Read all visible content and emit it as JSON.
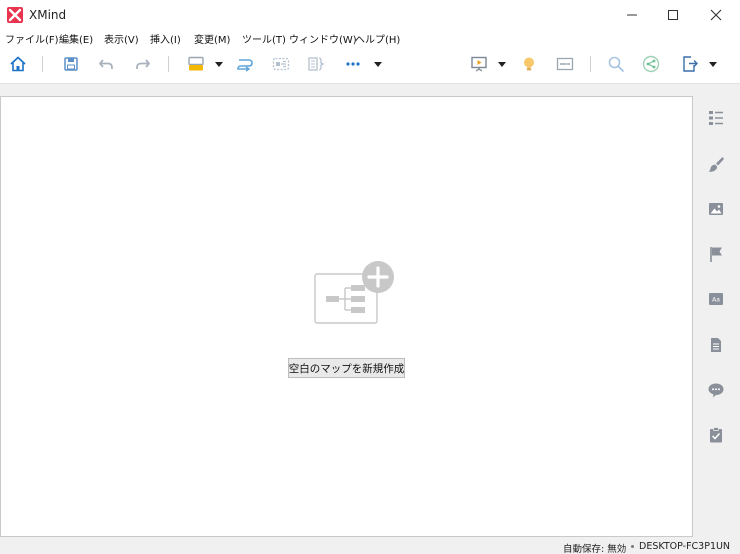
{
  "window": {
    "title": "XMind",
    "controls": [
      "minimize",
      "maximize",
      "close"
    ]
  },
  "menu": {
    "items": [
      "ファイル(F)",
      "編集(E)",
      "表示(V)",
      "挿入(I)",
      "変更(M)",
      "ツール(T)",
      "ウィンドウ(W)",
      "ヘルプ(H)"
    ]
  },
  "toolbar": {
    "icons": [
      "home-icon",
      "save-icon",
      "undo-icon",
      "redo-icon",
      "topic-style-icon",
      "relationship-icon",
      "boundary-icon",
      "summary-icon",
      "more-icon",
      "presentation-icon",
      "brainstorm-icon",
      "outline-mode-icon",
      "search-icon",
      "share-icon",
      "export-icon"
    ]
  },
  "canvas": {
    "new_map_button": "空白のマップを新規作成"
  },
  "sidebar": {
    "icons": [
      "outliner-icon",
      "format-icon",
      "image-icon",
      "marker-icon",
      "clipart-icon",
      "notes-icon",
      "comments-icon",
      "task-icon"
    ]
  },
  "status": {
    "autosave": "自動保存: 無効",
    "host": "DESKTOP-FC3P1UN"
  },
  "colors": {
    "brand": "#e8344e",
    "accent_blue": "#1e73c8",
    "toolbar_icon": "#9fb3c8",
    "sidebar_icon": "#8a9099",
    "window_bg": "#f0f0f0"
  }
}
